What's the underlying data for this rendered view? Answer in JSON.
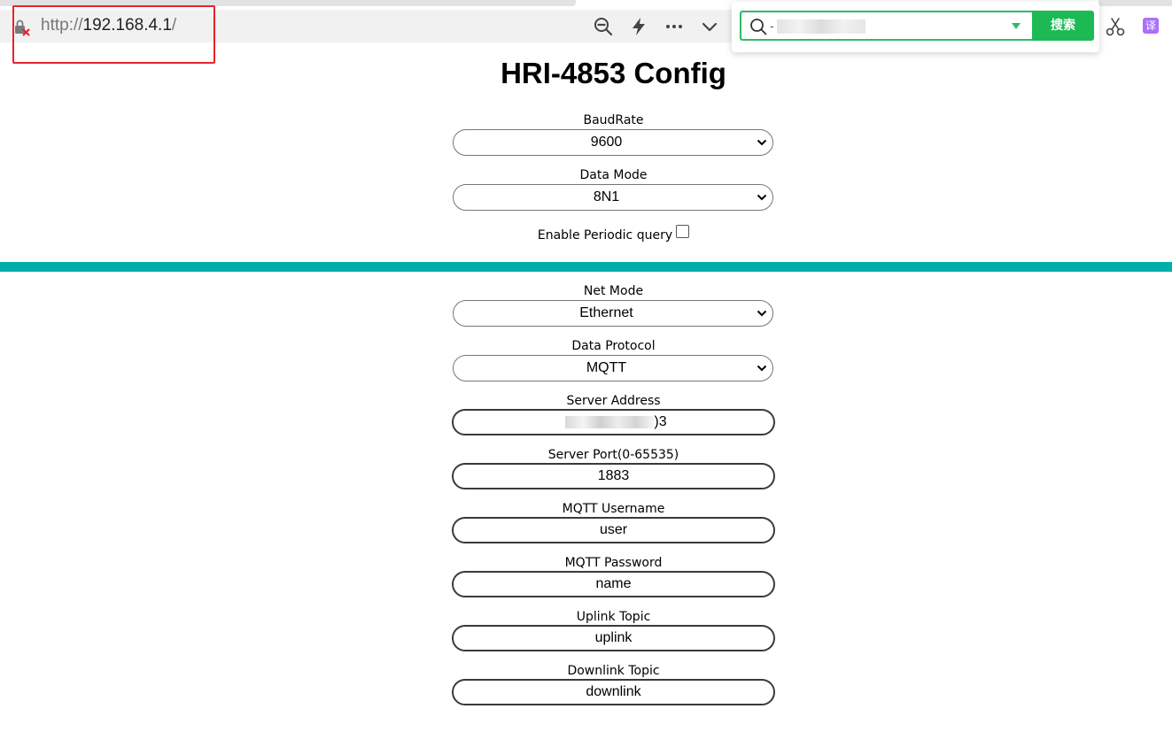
{
  "browser": {
    "url_proto": "http://",
    "url_host": "192.168.4.1",
    "url_slash": "/",
    "search_button_label": "搜索",
    "search_query_prefix": "-",
    "translate_label": "译"
  },
  "page": {
    "title": "HRI-4853 Config",
    "serial": {
      "baud_label": "BaudRate",
      "baud_value": "9600",
      "data_mode_label": "Data Mode",
      "data_mode_value": "8N1",
      "periodic_label": "Enable Periodic query",
      "periodic_checked": false
    },
    "network": {
      "net_mode_label": "Net Mode",
      "net_mode_value": "Ethernet",
      "protocol_label": "Data Protocol",
      "protocol_value": "MQTT",
      "server_address_label": "Server Address",
      "server_address_suffix": ")3",
      "server_port_label": "Server Port(0-65535)",
      "server_port_value": "1883",
      "mqtt_username_label": "MQTT Username",
      "mqtt_username_value": "user",
      "mqtt_password_label": "MQTT Password",
      "mqtt_password_value": "name",
      "uplink_label": "Uplink Topic",
      "uplink_value": "uplink",
      "downlink_label": "Downlink Topic",
      "downlink_value": "downlink"
    }
  },
  "colors": {
    "divider": "#00aeac",
    "search_green": "#1db954",
    "highlight_red": "#e8232b"
  }
}
